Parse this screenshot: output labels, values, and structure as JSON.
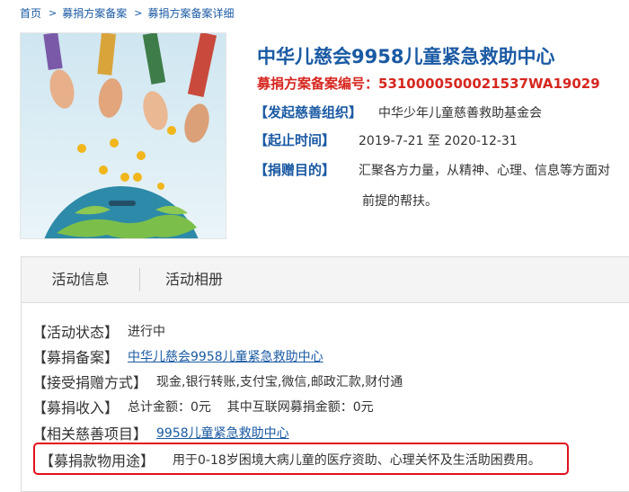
{
  "breadcrumb": {
    "items": [
      "首页",
      "募捐方案备案",
      "募捐方案备案详细"
    ],
    "separator": ">"
  },
  "project": {
    "title": "中华儿慈会9958儿童紧急救助中心",
    "registration": "募捐方案备案编号：5310000500021537WA19029",
    "organizer_label": "【发起慈善组织】",
    "organizer_value": "中华少年儿童慈善救助基金会",
    "period_label": "【起止时间】",
    "period_value": "2019-7-21 至 2020-12-31",
    "purpose_label": "【捐赠目的】",
    "purpose_value_line1": "汇聚各方力量，从精神、心理、信息等方面对",
    "purpose_value_line2": "前提的帮扶。"
  },
  "tabs": [
    {
      "label": "活动信息"
    },
    {
      "label": "活动相册"
    }
  ],
  "details": {
    "status_label": "【活动状态】",
    "status_value": "进行中",
    "filing_label": "【募捐备案】",
    "filing_value": "中华儿慈会9958儿童紧急救助中心",
    "methods_label": "【接受捐赠方式】",
    "methods_value": "现金,银行转账,支付宝,微信,邮政汇款,财付通",
    "income_label": "【募捐收入】",
    "income_value": "总计金额：0元    其中互联网募捐金额：0元",
    "project_label": "【相关慈善项目】",
    "project_value": "9958儿童紧急救助中心",
    "usage_label": "【募捐款物用途】",
    "usage_value": "用于0-18岁困境大病儿童的医疗资助、心理关怀及生活助困费用。"
  },
  "colors": {
    "link_blue": "#1a5aa3",
    "registration_red": "#d6261f",
    "highlight_red": "#e0111c"
  }
}
